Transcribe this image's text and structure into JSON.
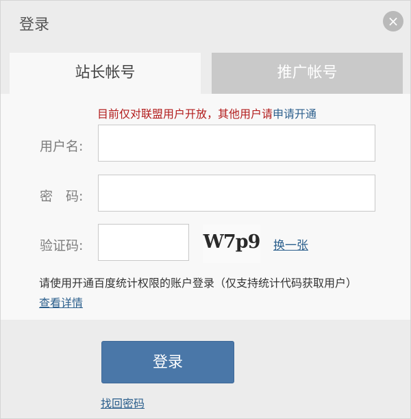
{
  "dialog": {
    "title": "登录",
    "close_symbol": "×"
  },
  "tabs": [
    {
      "label": "站长帐号",
      "active": true
    },
    {
      "label": "推广帐号",
      "active": false
    }
  ],
  "notice": {
    "text": "目前仅对联盟用户开放，其他用户请",
    "apply_link": "申请开通"
  },
  "form": {
    "username_label": "用户名:",
    "username_value": "",
    "password_label": "密　码:",
    "password_value": "",
    "captcha_label": "验证码:",
    "captcha_value": "",
    "captcha_image_text": "W7p9",
    "refresh_link": "换一张"
  },
  "info": {
    "text": "请使用开通百度统计权限的账户登录（仅支持统计代码获取用户）",
    "details_link": "查看详情"
  },
  "actions": {
    "login_label": "登录",
    "recover_link": "找回密码"
  },
  "colors": {
    "accent": "#4a77a8",
    "notice": "#b21b1b",
    "link": "#2a5e8c"
  }
}
